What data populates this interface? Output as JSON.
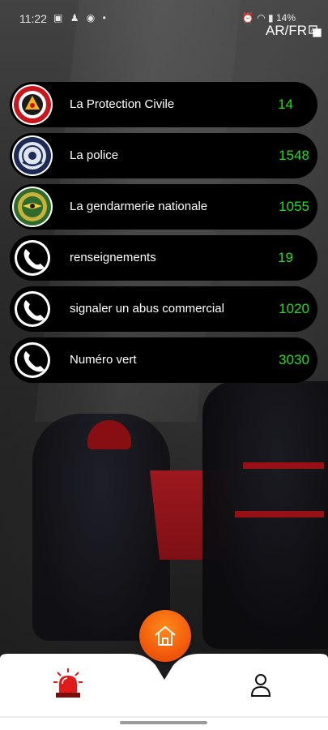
{
  "status_bar": {
    "time": "11:22",
    "left_icons": [
      "gallery-icon",
      "snapchat-icon",
      "messenger-icon",
      "dot-icon"
    ],
    "right_icons": [
      "alarm-icon",
      "wifi-icon",
      "signal-icon"
    ],
    "battery": "14%"
  },
  "language_toggle": "AR/FR",
  "contacts": [
    {
      "name": "La Protection Civile",
      "number": "14",
      "icon": "protection-civile-logo"
    },
    {
      "name": "La police",
      "number": "1548",
      "icon": "police-logo"
    },
    {
      "name": "La gendarmerie nationale",
      "number": "1055",
      "icon": "gendarmerie-logo"
    },
    {
      "name": "renseignements",
      "number": "19",
      "icon": "phone-icon"
    },
    {
      "name": "signaler un abus commercial",
      "number": "1020",
      "icon": "phone-icon"
    },
    {
      "name": "Numéro vert",
      "number": "3030",
      "icon": "phone-icon"
    }
  ],
  "bottom_nav": {
    "items": [
      "siren-icon",
      "home-icon",
      "user-icon"
    ]
  },
  "colors": {
    "number_green": "#22dd22",
    "fab_orange": "#f25c0c",
    "siren_red": "#e01b1b"
  }
}
